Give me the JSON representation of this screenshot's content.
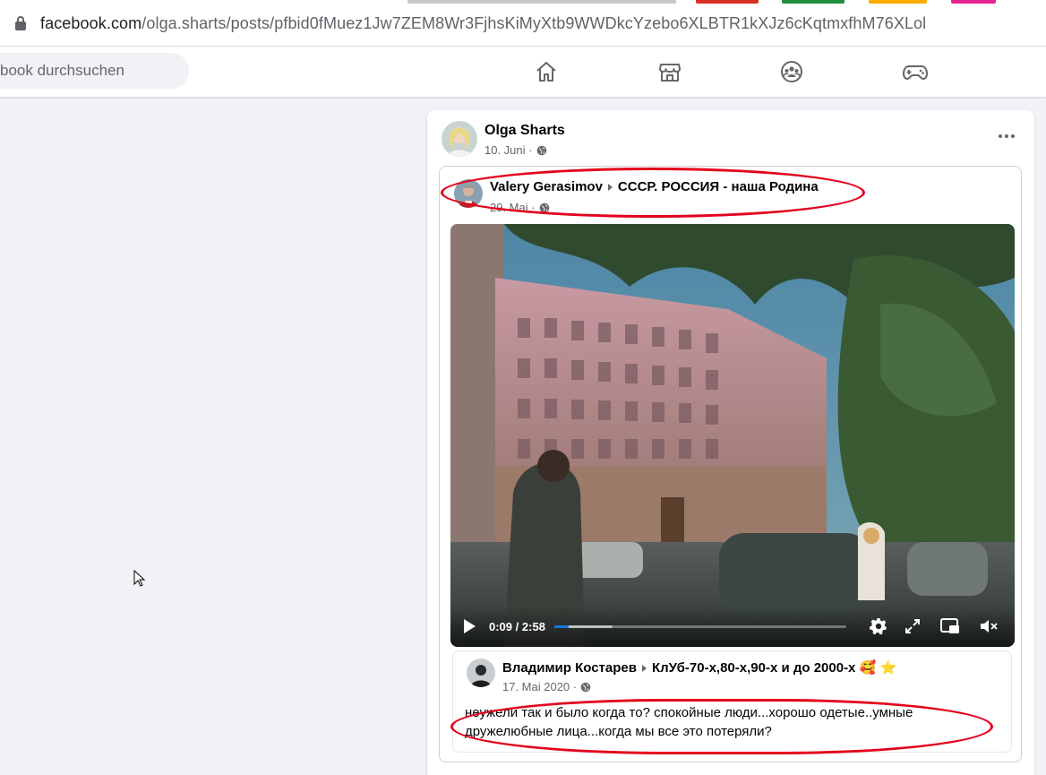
{
  "browser": {
    "url_host": "facebook.com",
    "url_path": "/olga.sharts/posts/pfbid0fMuez1Jw7ZEM8Wr3FjhsKiMyXtb9WWDkcYzebo6XLBTR1kXJz6cKqtmxfhM76XLol",
    "tab_hint_colors": [
      "#c9c9c9",
      "#d93025",
      "#1e8e3e",
      "#f9ab00",
      "#e52592"
    ]
  },
  "header": {
    "search_placeholder": "book durchsuchen",
    "nav_icons": [
      "home-icon",
      "marketplace-icon",
      "groups-icon",
      "gaming-icon"
    ]
  },
  "post": {
    "author": "Olga Sharts",
    "date": "10. Juni",
    "privacy_icon": "globe-icon",
    "shared": {
      "author": "Valery Gerasimov",
      "group": "СССР. РОССИЯ - наша Родина",
      "date": "29. Mai",
      "video": {
        "current_time": "0:09",
        "separator": "/",
        "duration": "2:58",
        "progress_fraction": 0.05,
        "buffered_fraction": 0.2
      },
      "inner": {
        "author": "Владимир Костарев",
        "group": "КлУб-70-х,80-х,90-х и до 2000-х",
        "emoji_1": "🥰",
        "emoji_2": "⭐",
        "date": "17. Mai 2020",
        "caption": "неужели  так и было когда то? спокойные люди...хорошо одетые..умные дружелюбные лица...когда мы все это потеряли?"
      }
    }
  },
  "colors": {
    "fb_blue": "#1b74e4",
    "annotation_red": "#e3001b",
    "secondary_text": "#65676b"
  }
}
